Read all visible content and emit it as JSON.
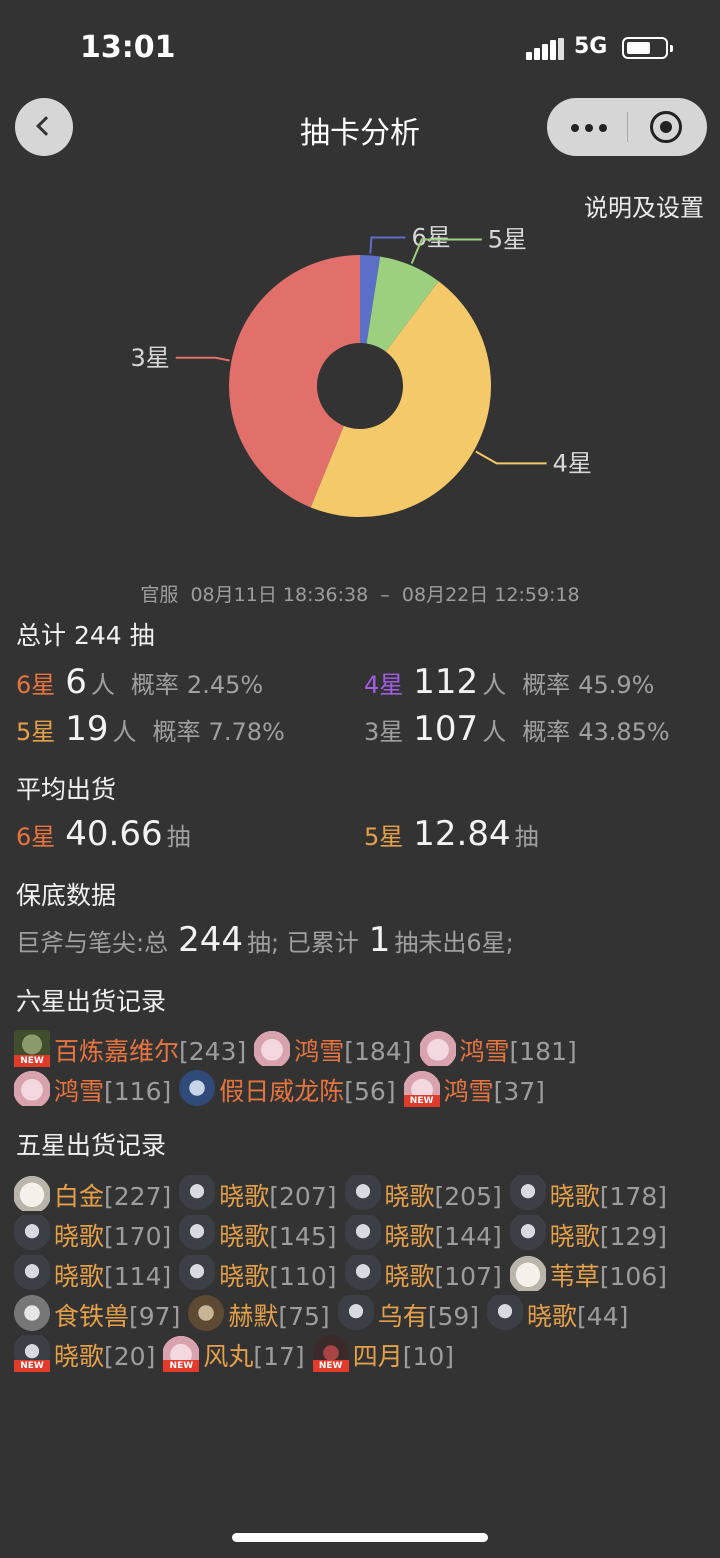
{
  "status": {
    "time": "13:01",
    "network": "5G",
    "battery_level": 0.65
  },
  "nav": {
    "title": "抽卡分析"
  },
  "settings_label": "说明及设置",
  "chart_data": {
    "type": "pie",
    "donut": true,
    "labels": [
      "6星",
      "5星",
      "4星",
      "3星"
    ],
    "values": [
      6,
      19,
      112,
      107
    ],
    "colors": [
      "#5b6fc9",
      "#9cd07f",
      "#f3c96a",
      "#e2706a"
    ]
  },
  "range": {
    "server": "官服",
    "start": "08月11日 18:36:38",
    "sep": "–",
    "end": "08月22日 12:59:18"
  },
  "totals": {
    "title": "总计 244 抽",
    "person_unit": "人",
    "prob_label": "概率",
    "rows": [
      {
        "star": "6星",
        "count": "6",
        "prob": "2.45%"
      },
      {
        "star": "4星",
        "count": "112",
        "prob": "45.9%"
      },
      {
        "star": "5星",
        "count": "19",
        "prob": "7.78%"
      },
      {
        "star": "3星",
        "count": "107",
        "prob": "43.85%"
      }
    ]
  },
  "average": {
    "title": "平均出货",
    "unit": "抽",
    "six": {
      "star": "6星",
      "value": "40.66"
    },
    "five": {
      "star": "5星",
      "value": "12.84"
    }
  },
  "pity": {
    "title": "保底数据",
    "pool": "巨斧与笔尖:总",
    "total": "244",
    "mid": "抽; 已累计",
    "current": "1",
    "tail": "抽未出6星;"
  },
  "six_star": {
    "title": "六星出货记录",
    "items": [
      {
        "name": "百炼嘉维尔",
        "pull": "[243]",
        "is_new": true,
        "avatar": "green"
      },
      {
        "name": "鸿雪",
        "pull": "[184]",
        "is_new": false,
        "avatar": "pink"
      },
      {
        "name": "鸿雪",
        "pull": "[181]",
        "is_new": false,
        "avatar": "pink"
      },
      {
        "name": "鸿雪",
        "pull": "[116]",
        "is_new": false,
        "avatar": "pink"
      },
      {
        "name": "假日威龙陈",
        "pull": "[56]",
        "is_new": false,
        "avatar": "blue"
      },
      {
        "name": "鸿雪",
        "pull": "[37]",
        "is_new": true,
        "avatar": "pink"
      }
    ]
  },
  "five_star": {
    "title": "五星出货记录",
    "items": [
      {
        "name": "白金",
        "pull": "[227]",
        "is_new": false,
        "avatar": "white"
      },
      {
        "name": "晓歌",
        "pull": "[207]",
        "is_new": false,
        "avatar": "dark"
      },
      {
        "name": "晓歌",
        "pull": "[205]",
        "is_new": false,
        "avatar": "dark"
      },
      {
        "name": "晓歌",
        "pull": "[178]",
        "is_new": false,
        "avatar": "dark"
      },
      {
        "name": "晓歌",
        "pull": "[170]",
        "is_new": false,
        "avatar": "dark"
      },
      {
        "name": "晓歌",
        "pull": "[145]",
        "is_new": false,
        "avatar": "dark"
      },
      {
        "name": "晓歌",
        "pull": "[144]",
        "is_new": false,
        "avatar": "dark"
      },
      {
        "name": "晓歌",
        "pull": "[129]",
        "is_new": false,
        "avatar": "dark"
      },
      {
        "name": "晓歌",
        "pull": "[114]",
        "is_new": false,
        "avatar": "dark"
      },
      {
        "name": "晓歌",
        "pull": "[110]",
        "is_new": false,
        "avatar": "dark"
      },
      {
        "name": "晓歌",
        "pull": "[107]",
        "is_new": false,
        "avatar": "dark"
      },
      {
        "name": "苇草",
        "pull": "[106]",
        "is_new": false,
        "avatar": "white"
      },
      {
        "name": "食铁兽",
        "pull": "[97]",
        "is_new": false,
        "avatar": "grey"
      },
      {
        "name": "赫默",
        "pull": "[75]",
        "is_new": false,
        "avatar": "brown"
      },
      {
        "name": "乌有",
        "pull": "[59]",
        "is_new": false,
        "avatar": "dark"
      },
      {
        "name": "晓歌",
        "pull": "[44]",
        "is_new": false,
        "avatar": "dark"
      },
      {
        "name": "晓歌",
        "pull": "[20]",
        "is_new": true,
        "avatar": "dark"
      },
      {
        "name": "风丸",
        "pull": "[17]",
        "is_new": true,
        "avatar": "pink"
      },
      {
        "name": "四月",
        "pull": "[10]",
        "is_new": true,
        "avatar": "red"
      }
    ]
  },
  "new_badge_text": "NEW"
}
